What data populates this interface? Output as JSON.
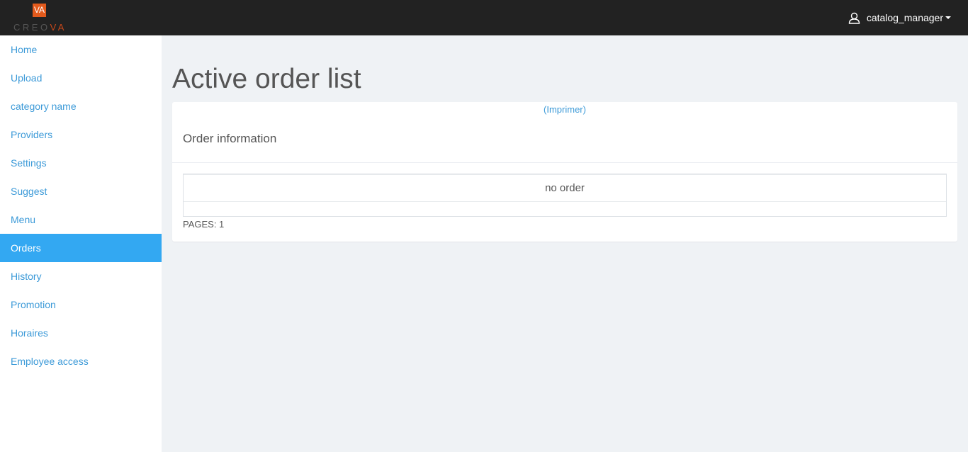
{
  "brand": {
    "logo_mark": "VA",
    "logo_text_prefix": "CREO",
    "logo_text_suffix": "VA",
    "accent_color": "#e35a1c"
  },
  "header": {
    "user_name": "catalog_manager",
    "user_icon": "user-icon"
  },
  "sidebar": {
    "items": [
      {
        "label": "Home",
        "active": false
      },
      {
        "label": "Upload",
        "active": false
      },
      {
        "label": "category name",
        "active": false
      },
      {
        "label": "Providers",
        "active": false
      },
      {
        "label": "Settings",
        "active": false
      },
      {
        "label": "Suggest",
        "active": false
      },
      {
        "label": "Menu",
        "active": false
      },
      {
        "label": "Orders",
        "active": true
      },
      {
        "label": "History",
        "active": false
      },
      {
        "label": "Promotion",
        "active": false
      },
      {
        "label": "Horaires",
        "active": false
      },
      {
        "label": "Employee access",
        "active": false
      }
    ],
    "active_color": "#33a8f2",
    "link_color": "#3c9ad8"
  },
  "main": {
    "title": "Active order list",
    "print_link": "(Imprimer)",
    "panel_heading": "Order information",
    "empty_message": "no order",
    "pages": "PAGES: 1"
  }
}
